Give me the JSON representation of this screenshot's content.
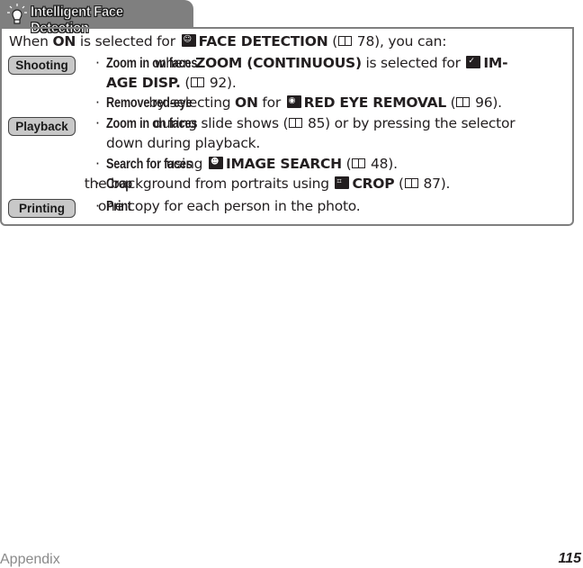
{
  "tab": {
    "title": "Intelligent Face Detection",
    "icon": "lightbulb-icon"
  },
  "intro": {
    "prefix": "When ",
    "on": "ON",
    "mid": " is selected for ",
    "setting": "FACE DETECTION",
    "ref_open": " (",
    "ref_page": " 78), you can:"
  },
  "sections": [
    {
      "label": "Shooting",
      "bullets": [
        {
          "bold": "Zoom in on faces",
          "text1": " when ",
          "setting1": "ZOOM (CONTINUOUS)",
          "text2": " is selected for ",
          "setting2a": "IM-",
          "setting2b": "AGE DISP.",
          "ref_page": " 92)."
        },
        {
          "bold": "Remove red-eye",
          "text1": " by selecting ",
          "on": "ON",
          "text2": " for ",
          "setting": "RED EYE REMOVAL",
          "ref_page": " 96)."
        }
      ]
    },
    {
      "label": "Playback",
      "bullets": [
        {
          "bold": "Zoom in on faces",
          "text1": " during slide shows (",
          "ref_page": " 85) or by pressing the selector",
          "line2": "down during playback."
        },
        {
          "bold": "Search for faces",
          "text1": " using ",
          "setting": "IMAGE SEARCH",
          "ref_page": " 48)."
        },
        {
          "bold": "Crop",
          "text1": " the background from portraits using ",
          "setting": "CROP",
          "ref_page": " 87)."
        }
      ]
    },
    {
      "label": "Printing",
      "bullets": [
        {
          "bold": "Print",
          "text1": " one copy for each person in the photo."
        }
      ]
    }
  ],
  "footer": {
    "section": "Appendix",
    "page_number": "115"
  }
}
